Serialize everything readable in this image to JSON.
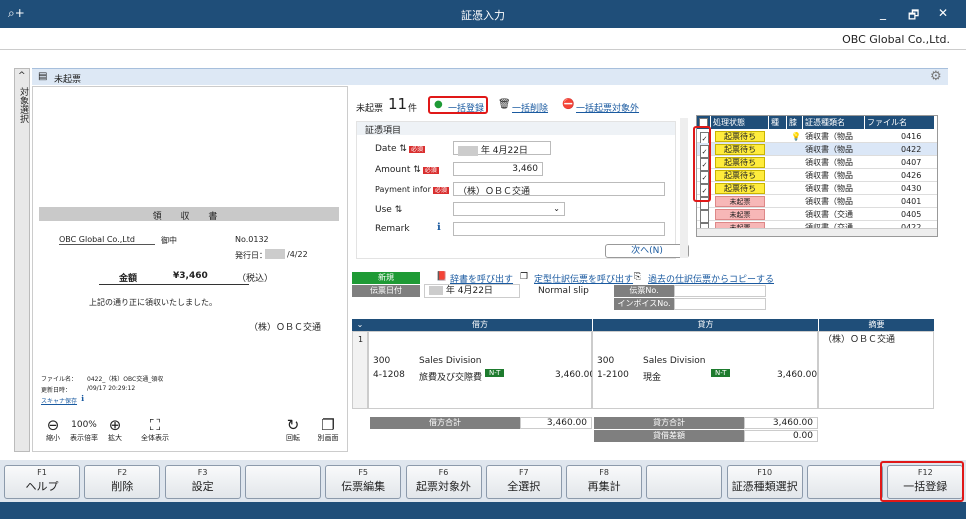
{
  "window": {
    "title": "証憑入力",
    "minimize": "_",
    "restore": "🗗",
    "close": "✕"
  },
  "company": "OBC Global Co.,Ltd.",
  "side_tab": "対象選択",
  "header": {
    "title": "未起票"
  },
  "receipt": {
    "title": "領 収 書",
    "to": "OBC Global Co.,Ltd",
    "honorific": "御中",
    "no": "No.0132",
    "issue_label": "発行日：",
    "issue_date": "/4/22",
    "amount_label": "金額",
    "amount": "¥3,460",
    "tax": "（税込）",
    "note": "上記の通り正に領収いたしました。",
    "issuer": "（株）ＯＢＣ交通",
    "file_label": "ファイル名：",
    "file_name": "0422_（株）OBC交通_領収",
    "updated_label": "更新日時：",
    "updated": "/09/17 20:29:12",
    "scanner": "スキャナ保存",
    "zoom": "100%",
    "zoom_out": "縮小",
    "zoom_rate": "表示倍率",
    "zoom_in": "拡大",
    "fit": "全体表示",
    "rotate": "回転",
    "other": "別画面"
  },
  "summary": {
    "label": "未起票",
    "count": "11",
    "unit": "件",
    "register": "一括登録",
    "delete": "一括削除",
    "exclude": "一括起票対象外"
  },
  "form": {
    "section": "証憑項目",
    "date_label": "Date",
    "date_value": "年  4月22日",
    "amount_label": "Amount",
    "amount_value": "3,460",
    "payment_label": "Payment infor",
    "payment_value": "（株）ＯＢＣ交通",
    "use_label": "Use",
    "use_value": "",
    "remark_label": "Remark",
    "remark_value": "",
    "required": "必須",
    "next": "次へ(N)"
  },
  "grid": {
    "headers": [
      "処理状態",
      "種",
      "膝",
      "証憑種類名",
      "ファイル名"
    ],
    "rows": [
      {
        "checked": true,
        "status": "起票待ち",
        "kind": "",
        "mark": "💡",
        "type": "領収書（物品",
        "file": "0416"
      },
      {
        "checked": true,
        "status": "起票待ち",
        "kind": "",
        "mark": "",
        "type": "領収書（物品",
        "file": "0422"
      },
      {
        "checked": true,
        "status": "起票待ち",
        "kind": "",
        "mark": "",
        "type": "領収書（物品",
        "file": "0407"
      },
      {
        "checked": true,
        "status": "起票待ち",
        "kind": "",
        "mark": "",
        "type": "領収書（物品",
        "file": "0426"
      },
      {
        "checked": true,
        "status": "起票待ち",
        "kind": "",
        "mark": "",
        "type": "領収書（物品",
        "file": "0430"
      },
      {
        "checked": false,
        "status": "未起票",
        "kind": "",
        "mark": "",
        "type": "領収書（物品",
        "file": "0401"
      },
      {
        "checked": false,
        "status": "未起票",
        "kind": "",
        "mark": "",
        "type": "領収書（交通",
        "file": "0405"
      },
      {
        "checked": false,
        "status": "未起票",
        "kind": "",
        "mark": "",
        "type": "領収書（交通",
        "file": "0422"
      }
    ]
  },
  "journal": {
    "new_badge": "新規",
    "date_label": "伝票日付",
    "date_value": "年  4月22日",
    "slip_type": "Normal slip",
    "link_dict": "辞書を呼び出す",
    "link_fixed": "定型仕訳伝票を呼び出す",
    "link_copy": "過去の仕訳伝票からコピーする",
    "slip_no_label": "伝票No.",
    "invoice_label": "インボイスNo.",
    "debit_header": "借方",
    "credit_header": "貸方",
    "memo_header": "摘要",
    "row_no": "1",
    "debit": {
      "code": "300",
      "dept": "Sales Division",
      "sub": "4-1208",
      "account": "旅費及び交際費",
      "tax": "N-T",
      "amount": "3,460.00"
    },
    "credit": {
      "code": "300",
      "dept": "Sales Division",
      "sub": "1-2100",
      "account": "現金",
      "tax": "N-T",
      "amount": "3,460.00"
    },
    "memo": "（株）ＯＢＣ交通",
    "debit_total_label": "借方合計",
    "debit_total": "3,460.00",
    "credit_total_label": "貸方合計",
    "credit_total": "3,460.00",
    "diff_label": "貸借差額",
    "diff": "0.00"
  },
  "fkeys": [
    {
      "key": "F1",
      "label": "ヘルプ"
    },
    {
      "key": "F2",
      "label": "削除"
    },
    {
      "key": "F3",
      "label": "設定"
    },
    {
      "key": "",
      "label": ""
    },
    {
      "key": "F5",
      "label": "伝票編集"
    },
    {
      "key": "F6",
      "label": "起票対象外"
    },
    {
      "key": "F7",
      "label": "全選択"
    },
    {
      "key": "F8",
      "label": "再集計"
    },
    {
      "key": "",
      "label": ""
    },
    {
      "key": "F10",
      "label": "証憑種類選択"
    },
    {
      "key": "",
      "label": ""
    },
    {
      "key": "F12",
      "label": "一括登録"
    }
  ]
}
